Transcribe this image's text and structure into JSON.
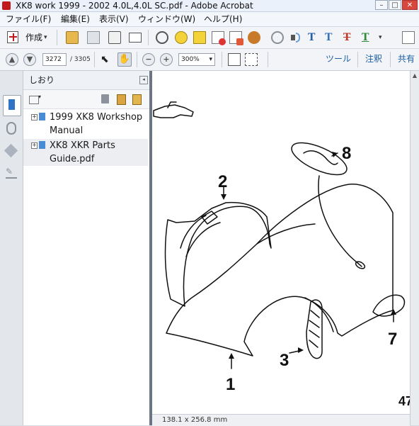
{
  "window": {
    "title": "XK8 work 1999 - 2002 4.0L,4.0L SC.pdf - Adobe Acrobat",
    "controls": {
      "minimize": "–",
      "maximize": "□",
      "close": "✕"
    }
  },
  "menu": {
    "items": [
      "ファイル(F)",
      "編集(E)",
      "表示(V)",
      "ウィンドウ(W)",
      "ヘルプ(H)"
    ]
  },
  "toolbar": {
    "create_label": "作成",
    "create_caret": "▾",
    "page_current": "3272",
    "page_total": "/ 3305",
    "zoom_value": "300%",
    "zoom_caret": "▾",
    "right_links": [
      "ツール",
      "注釈",
      "共有"
    ]
  },
  "bookmarks": {
    "title": "しおり",
    "items": [
      {
        "label": "1999 XK8 Workshop\nManual",
        "expander": "+"
      },
      {
        "label": "XK8 XKR Parts\nGuide.pdf",
        "expander": "+"
      }
    ]
  },
  "document": {
    "callouts": [
      "8",
      "2",
      "3",
      "7",
      "1"
    ],
    "page_number": "47"
  },
  "status": {
    "dimensions": "138.1 x 256.8 mm"
  },
  "colors": {
    "accent_link": "#1b5ea6",
    "title_bar": "#eaf1fb",
    "toolbar_bg": "#f2f4f7",
    "splitter": "#6c7582"
  },
  "icons": {
    "rail": [
      "bookmark-icon",
      "attachment-icon",
      "layers-icon",
      "signature-icon"
    ],
    "toolbar1": [
      "open-folder-icon",
      "save-icon",
      "print-icon",
      "email-icon",
      "settings-icon",
      "comment-icon",
      "sticky-note-icon",
      "delete-page-icon",
      "stamp-icon",
      "link-icon",
      "audio-icon",
      "text-edit-icon",
      "strikethrough-icon",
      "highlight-icon",
      "expand-icon"
    ]
  }
}
